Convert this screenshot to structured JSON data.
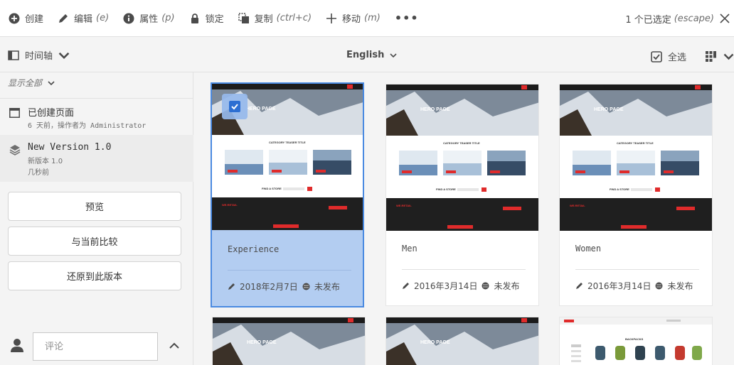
{
  "toolbar": {
    "create": {
      "label": "创建",
      "icon": "plus-circle-icon"
    },
    "edit": {
      "label": "编辑",
      "hint": "(e)",
      "icon": "pencil-icon"
    },
    "properties": {
      "label": "属性",
      "hint": "(p)",
      "icon": "info-icon"
    },
    "lock": {
      "label": "锁定",
      "icon": "lock-icon"
    },
    "copy": {
      "label": "复制",
      "hint": "(ctrl+c)",
      "icon": "copy-icon"
    },
    "move": {
      "label": "移动",
      "hint": "(m)",
      "icon": "move-icon"
    },
    "more": "•••",
    "selection": {
      "label": "1 个已选定",
      "hint": "(escape)"
    }
  },
  "subbar": {
    "rail_label": "时间轴",
    "language": "English",
    "select_all": "全选"
  },
  "rail": {
    "show_all": "显示全部",
    "entries": [
      {
        "title": "已创建页面",
        "sub": "6 天前，操作者为 Administrator",
        "icon": "page-icon"
      },
      {
        "title": "New Version 1.0",
        "sub": "新版本 1.0",
        "sub2": "几秒前",
        "icon": "layers-icon"
      }
    ],
    "buttons": [
      "预览",
      "与当前比较",
      "还原到此版本"
    ],
    "comment_placeholder": "评论"
  },
  "cards": [
    {
      "title": "Experience",
      "date": "2018年2月7日",
      "status": "未发布",
      "selected": true
    },
    {
      "title": "Men",
      "date": "2016年3月14日",
      "status": "未发布",
      "selected": false
    },
    {
      "title": "Women",
      "date": "2016年3月14日",
      "status": "未发布",
      "selected": false
    }
  ],
  "thumb_text": {
    "hero": "HERO PAGE",
    "category": "CATEGORY TEASER TITLE",
    "store": "FIND A STORE",
    "brand": "WE.RETAIL",
    "backpacks": "BACKPACKS"
  },
  "colors": {
    "accent": "#2d6fd2",
    "selected_bg": "#b3cdf1",
    "brand_red": "#e02b2b"
  }
}
